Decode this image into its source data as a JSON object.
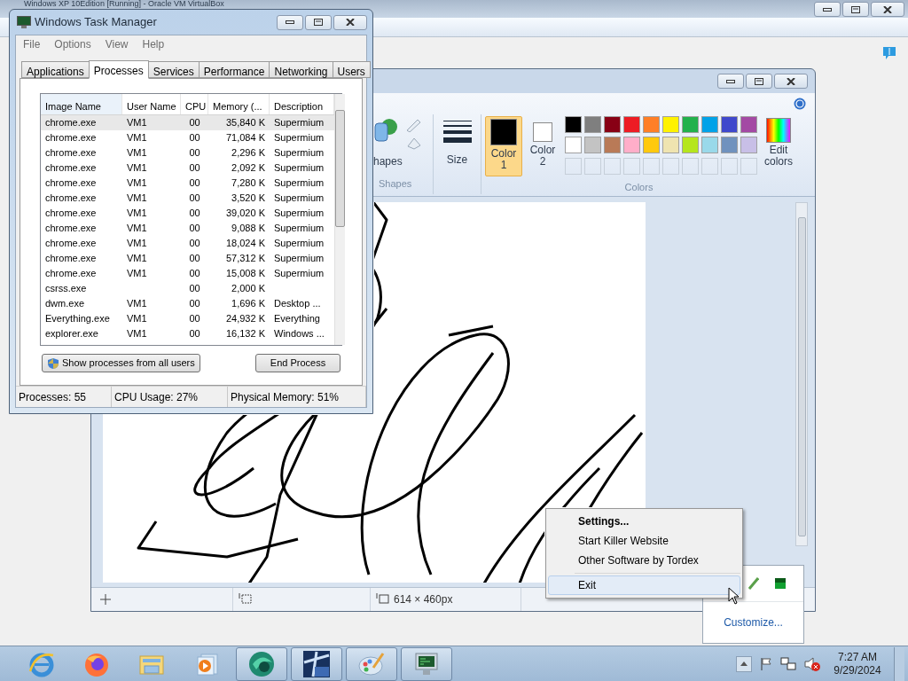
{
  "host_window": {
    "title": "Windows XP 10Edition [Running] - Oracle VM VirtualBox"
  },
  "paint": {
    "ribbon": {
      "shapes_button": "hapes",
      "shapes_group": "Shapes",
      "size_button": "Size",
      "color_slots": [
        {
          "label": "Color 1",
          "color": "#000000",
          "selected": true
        },
        {
          "label": "Color 2",
          "color": "#ffffff",
          "selected": false
        }
      ],
      "palette": [
        {
          "color": "#000000"
        },
        {
          "color": "#7f7f7f"
        },
        {
          "color": "#880015"
        },
        {
          "color": "#ed1c24"
        },
        {
          "color": "#ff7f27"
        },
        {
          "color": "#fff200"
        },
        {
          "color": "#22b14c"
        },
        {
          "color": "#00a2e8"
        },
        {
          "color": "#3f48cc"
        },
        {
          "color": "#a349a4"
        },
        {
          "color": "#ffffff"
        },
        {
          "color": "#c3c3c3"
        },
        {
          "color": "#b97a57"
        },
        {
          "color": "#ffaec9"
        },
        {
          "color": "#ffc90e"
        },
        {
          "color": "#efe4b0"
        },
        {
          "color": "#b5e61d"
        },
        {
          "color": "#99d9ea"
        },
        {
          "color": "#7092be"
        },
        {
          "color": "#c8bfe7"
        }
      ],
      "edit_colors": "Edit colors",
      "colors_group": "Colors"
    },
    "status_bar": {
      "size": "614 × 460px"
    }
  },
  "task_manager": {
    "title": "Windows Task Manager",
    "menu": [
      "File",
      "Options",
      "View",
      "Help"
    ],
    "tabs": [
      {
        "label": "Applications",
        "selected": false
      },
      {
        "label": "Processes",
        "selected": true
      },
      {
        "label": "Services",
        "selected": false
      },
      {
        "label": "Performance",
        "selected": false
      },
      {
        "label": "Networking",
        "selected": false
      },
      {
        "label": "Users",
        "selected": false
      }
    ],
    "columns": [
      "Image Name",
      "User Name",
      "CPU",
      "Memory (...",
      "Description"
    ],
    "rows": [
      {
        "image": "chrome.exe",
        "user": "VM1",
        "cpu": "00",
        "memory": "35,840 K",
        "description": "Supermium",
        "selected": true
      },
      {
        "image": "chrome.exe",
        "user": "VM1",
        "cpu": "00",
        "memory": "71,084 K",
        "description": "Supermium",
        "selected": false
      },
      {
        "image": "chrome.exe",
        "user": "VM1",
        "cpu": "00",
        "memory": "2,296 K",
        "description": "Supermium",
        "selected": false
      },
      {
        "image": "chrome.exe",
        "user": "VM1",
        "cpu": "00",
        "memory": "2,092 K",
        "description": "Supermium",
        "selected": false
      },
      {
        "image": "chrome.exe",
        "user": "VM1",
        "cpu": "00",
        "memory": "7,280 K",
        "description": "Supermium",
        "selected": false
      },
      {
        "image": "chrome.exe",
        "user": "VM1",
        "cpu": "00",
        "memory": "3,520 K",
        "description": "Supermium",
        "selected": false
      },
      {
        "image": "chrome.exe",
        "user": "VM1",
        "cpu": "00",
        "memory": "39,020 K",
        "description": "Supermium",
        "selected": false
      },
      {
        "image": "chrome.exe",
        "user": "VM1",
        "cpu": "00",
        "memory": "9,088 K",
        "description": "Supermium",
        "selected": false
      },
      {
        "image": "chrome.exe",
        "user": "VM1",
        "cpu": "00",
        "memory": "18,024 K",
        "description": "Supermium",
        "selected": false
      },
      {
        "image": "chrome.exe",
        "user": "VM1",
        "cpu": "00",
        "memory": "57,312 K",
        "description": "Supermium",
        "selected": false
      },
      {
        "image": "chrome.exe",
        "user": "VM1",
        "cpu": "00",
        "memory": "15,008 K",
        "description": "Supermium",
        "selected": false
      },
      {
        "image": "csrss.exe",
        "cpu": "00",
        "memory": "2,000 K",
        "selected": false
      },
      {
        "image": "dwm.exe",
        "user": "VM1",
        "cpu": "00",
        "memory": "1,696 K",
        "description": "Desktop ...",
        "selected": false
      },
      {
        "image": "Everything.exe",
        "user": "VM1",
        "cpu": "00",
        "memory": "24,932 K",
        "description": "Everything",
        "selected": false
      },
      {
        "image": "explorer.exe",
        "user": "VM1",
        "cpu": "00",
        "memory": "16,132 K",
        "description": "Windows ...",
        "selected": false
      }
    ],
    "show_all_button": "Show processes from all users",
    "end_button": "End Process",
    "status": [
      "Processes: 55",
      "CPU Usage: 27%",
      "Physical Memory: 51%"
    ]
  },
  "context_menu": {
    "items": [
      {
        "kind": "item",
        "label": "Settings...",
        "default": true,
        "selected": false
      },
      {
        "kind": "item",
        "label": "Start Killer Website",
        "default": false,
        "selected": false
      },
      {
        "kind": "item",
        "label": "Other Software by Tordex",
        "default": false,
        "selected": false
      },
      {
        "kind": "separator"
      },
      {
        "kind": "item",
        "label": "Exit",
        "default": false,
        "selected": true
      }
    ]
  },
  "tray_overflow": {
    "customize": "Customize..."
  },
  "taskbar": {
    "items": [
      {
        "kind": "ie",
        "running": false
      },
      {
        "kind": "firefox",
        "running": false
      },
      {
        "kind": "folder",
        "running": false
      },
      {
        "kind": "media",
        "running": false
      },
      {
        "kind": "orb",
        "running": true
      },
      {
        "kind": "xp",
        "running": true
      },
      {
        "kind": "palette",
        "running": true
      },
      {
        "kind": "monitor",
        "running": true
      }
    ],
    "time": "7:27 AM",
    "date": "9/29/2024"
  }
}
